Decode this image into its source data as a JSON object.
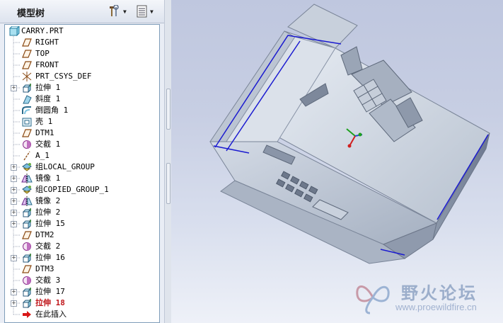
{
  "tree_panel": {
    "title": "模型树",
    "tools_icon": "hammer-wrench-icon",
    "show_icon": "tree-list-icon"
  },
  "tree": {
    "root": {
      "label": "CARRY.PRT",
      "icon": "part-icon"
    },
    "items": [
      {
        "label": "RIGHT",
        "icon": "datum-plane-icon",
        "expandable": false
      },
      {
        "label": "TOP",
        "icon": "datum-plane-icon",
        "expandable": false
      },
      {
        "label": "FRONT",
        "icon": "datum-plane-icon",
        "expandable": false
      },
      {
        "label": "PRT_CSYS_DEF",
        "icon": "coordinate-system-icon",
        "expandable": false
      },
      {
        "label": "拉伸 1",
        "icon": "extrude-icon",
        "expandable": true
      },
      {
        "label": "斜度 1",
        "icon": "draft-icon",
        "expandable": false
      },
      {
        "label": "倒圆角 1",
        "icon": "round-icon",
        "expandable": false
      },
      {
        "label": "壳 1",
        "icon": "shell-icon",
        "expandable": false
      },
      {
        "label": "DTM1",
        "icon": "datum-plane-icon",
        "expandable": false
      },
      {
        "label": "交截 1",
        "icon": "intersect-icon",
        "expandable": false
      },
      {
        "label": "A_1",
        "icon": "datum-axis-icon",
        "expandable": false
      },
      {
        "label": "组LOCAL_GROUP",
        "icon": "group-icon",
        "expandable": true
      },
      {
        "label": "镜像 1",
        "icon": "mirror-icon",
        "expandable": true
      },
      {
        "label": "组COPIED_GROUP_1",
        "icon": "group-icon",
        "expandable": true
      },
      {
        "label": "镜像 2",
        "icon": "mirror-icon",
        "expandable": true
      },
      {
        "label": "拉伸 2",
        "icon": "extrude-icon",
        "expandable": true
      },
      {
        "label": "拉伸 15",
        "icon": "extrude-icon",
        "expandable": true
      },
      {
        "label": "DTM2",
        "icon": "datum-plane-icon",
        "expandable": false
      },
      {
        "label": "交截 2",
        "icon": "intersect-icon",
        "expandable": false
      },
      {
        "label": "拉伸 16",
        "icon": "extrude-icon",
        "expandable": true
      },
      {
        "label": "DTM3",
        "icon": "datum-plane-icon",
        "expandable": false
      },
      {
        "label": "交截 3",
        "icon": "intersect-icon",
        "expandable": false
      },
      {
        "label": "拉伸 17",
        "icon": "extrude-icon",
        "expandable": true
      },
      {
        "label": "拉伸 18",
        "icon": "extrude-icon",
        "expandable": true,
        "active": true
      },
      {
        "label": "在此插入",
        "icon": "insert-here-arrow-icon",
        "expandable": false
      }
    ]
  },
  "watermark": {
    "text": "野火论坛",
    "url": "www.proewildfire.cn",
    "icon": "butterfly-logo-icon"
  },
  "colors": {
    "active_feature": "#c0181c",
    "edge_highlight": "#1b1bd0",
    "model_body": "#bfc8d6"
  }
}
